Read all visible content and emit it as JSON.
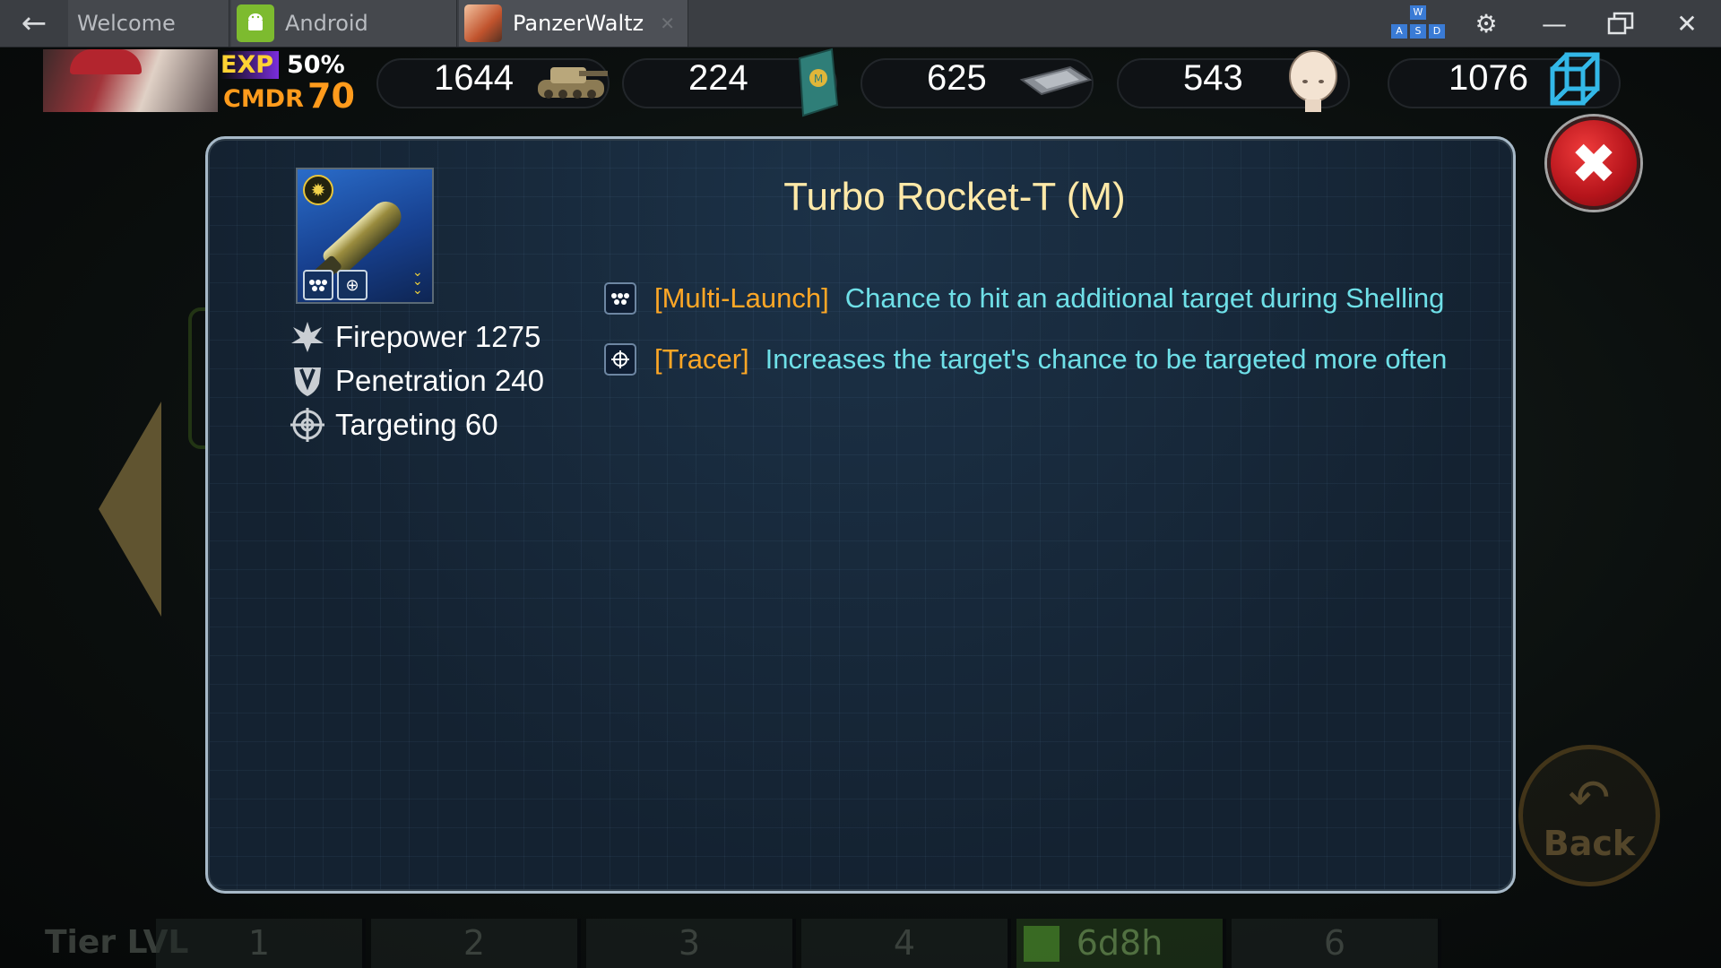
{
  "window": {
    "tabs": [
      {
        "label": "Welcome"
      },
      {
        "label": "Android"
      },
      {
        "label": "PanzerWaltz"
      }
    ],
    "wasd": [
      "W",
      "A",
      "S",
      "D"
    ],
    "icons": {
      "back": "back-arrow-icon",
      "settings": "gear-icon",
      "minimize": "minimize-icon",
      "restore": "restore-icon",
      "close": "close-icon"
    }
  },
  "hud": {
    "exp_label": "EXP",
    "exp_value": "50%",
    "cmdr_label": "CMDR",
    "cmdr_level": "70",
    "resources": [
      {
        "value": "1644",
        "icon": "tank-icon"
      },
      {
        "value": "224",
        "icon": "manual-book-icon"
      },
      {
        "value": "625",
        "icon": "chip-icon"
      },
      {
        "value": "543",
        "icon": "doll-head-icon"
      },
      {
        "value": "1076",
        "icon": "cube-icon"
      }
    ]
  },
  "modal": {
    "title": "Turbo Rocket-T (M)",
    "stats": [
      {
        "label": "Firepower 1275",
        "icon": "explosion-icon"
      },
      {
        "label": "Penetration 240",
        "icon": "shield-pierce-icon"
      },
      {
        "label": "Targeting 60",
        "icon": "crosshair-icon"
      }
    ],
    "traits": [
      {
        "tag": "[Multi-Launch]",
        "desc": "Chance to hit an additional target during Shelling",
        "icon": "multi-launch-icon"
      },
      {
        "tag": "[Tracer]",
        "desc": "Increases the target's chance to be targeted more often",
        "icon": "crosshair-icon"
      }
    ],
    "close_icon": "close-x-icon"
  },
  "background": {
    "back_label": "Back",
    "tier_label": "Tier LVL",
    "tiers": [
      "1",
      "2",
      "3",
      "4",
      "6d8h",
      "6"
    ]
  },
  "colors": {
    "title": "#ffe9a8",
    "trait_tag": "#ffa726",
    "trait_desc": "#6fe0e8",
    "modal_bg": "#162536",
    "close_red": "#d22a2f"
  }
}
